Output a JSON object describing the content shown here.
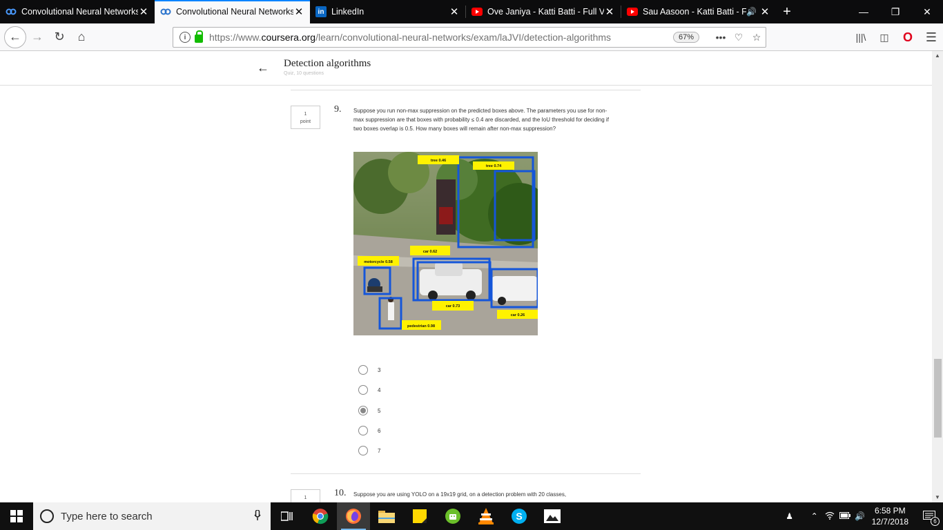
{
  "browser": {
    "tabs": [
      {
        "title": "Convolutional Neural Networks",
        "icon": "coursera-icon",
        "active": false
      },
      {
        "title": "Convolutional Neural Networks",
        "icon": "coursera-icon",
        "active": true
      },
      {
        "title": "LinkedIn",
        "icon": "linkedin-icon",
        "active": false
      },
      {
        "title": "Ove Janiya - Katti Batti - Full Video",
        "icon": "youtube-icon",
        "active": false
      },
      {
        "title": "Sau Aasoon - Katti Batti - Full Video",
        "icon": "youtube-icon",
        "active": false
      }
    ],
    "url_prefix": "https://www.",
    "url_domain": "coursera.org",
    "url_path": "/learn/convolutional-neural-networks/exam/laJVI/detection-algorithms",
    "zoom": "67%",
    "info_glyph": "i"
  },
  "quiz": {
    "title": "Detection algorithms",
    "subtitle": "Quiz, 10 questions",
    "questions": [
      {
        "number": "9.",
        "points": "1",
        "points_label": "point",
        "text": "Suppose you run non-max suppression on the predicted boxes above. The parameters you use for non-max suppression are that boxes with probability ≤ 0.4 are discarded, and the IoU threshold for deciding if two boxes overlap is 0.5. How many boxes will remain after non-max suppression?",
        "image_labels": [
          "tree 0.46",
          "tree 0.74",
          "car 0.62",
          "motorcycle 0.58",
          "car 0.73",
          "car 0.26",
          "pedestrian 0.98"
        ],
        "options": [
          "3",
          "4",
          "5",
          "6",
          "7"
        ],
        "selected": "5"
      },
      {
        "number": "10.",
        "points": "1",
        "text": "Suppose you are using YOLO on a 19x19 grid, on a detection problem with 20 classes,"
      }
    ]
  },
  "taskbar": {
    "search_placeholder": "Type here to search",
    "time": "6:58 PM",
    "date": "12/7/2018",
    "notifications": "6"
  }
}
